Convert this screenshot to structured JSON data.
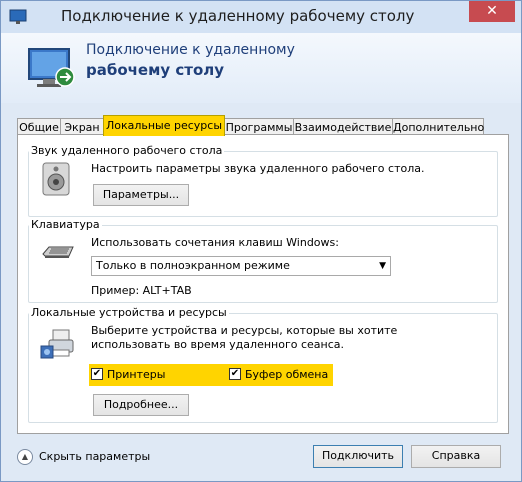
{
  "window": {
    "title": "Подключение к удаленному рабочему столу",
    "close": "✕"
  },
  "header": {
    "line1": "Подключение к удаленному",
    "line2": "рабочему столу"
  },
  "tabs": [
    {
      "label": "Общие"
    },
    {
      "label": "Экран"
    },
    {
      "label": "Локальные ресурсы"
    },
    {
      "label": "Программы"
    },
    {
      "label": "Взаимодействие"
    },
    {
      "label": "Дополнительно"
    }
  ],
  "sound": {
    "title": "Звук удаленного рабочего стола",
    "desc": "Настроить параметры звука удаленного рабочего стола.",
    "button": "Параметры..."
  },
  "keyboard": {
    "title": "Клавиатура",
    "desc": "Использовать сочетания клавиш Windows:",
    "selected": "Только в полноэкранном режиме",
    "example": "Пример: ALT+TAB"
  },
  "local": {
    "title": "Локальные устройства и ресурсы",
    "desc_line1": "Выберите устройства и ресурсы, которые вы хотите",
    "desc_line2": "использовать во время удаленного сеанса.",
    "printers": "Принтеры",
    "clipboard": "Буфер обмена",
    "more_button": "Подробнее..."
  },
  "footer": {
    "hide_options": "Скрыть параметры",
    "connect": "Подключить",
    "help": "Справка"
  }
}
